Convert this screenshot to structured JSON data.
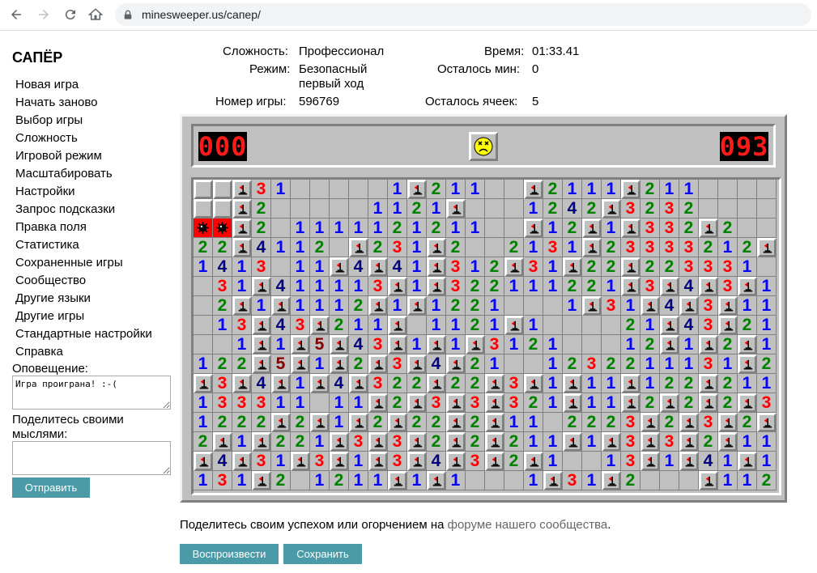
{
  "browser": {
    "url": "minesweeper.us/сапер/"
  },
  "sidebar": {
    "title": "САПЁР",
    "menu": [
      "Новая игра",
      "Начать заново",
      "Выбор игры",
      "Сложность",
      "Игровой режим",
      "Масштабировать",
      "Настройки",
      "Запрос подсказки",
      "Правка поля",
      "Статистика",
      "Сохраненные игры",
      "Сообщество",
      "Другие языки",
      "Другие игры",
      "Стандартные настройки",
      "Справка"
    ],
    "notice_label": "Оповещение:",
    "notice_text": "Игра проиграна! :-(",
    "share_label": "Поделитесь своими мыслями:",
    "send_button": "Отправить"
  },
  "info": {
    "difficulty_label": "Сложность:",
    "difficulty_value": "Профессионал",
    "mode_label": "Режим:",
    "mode_value_line1": "Безопасный",
    "mode_value_line2": "первый ход",
    "game_number_label": "Номер игры:",
    "game_number_value": "596769",
    "time_label": "Время:",
    "time_value": "01:33.41",
    "mines_left_label": "Осталось мин:",
    "mines_left_value": "0",
    "cells_left_label": "Осталось ячеек:",
    "cells_left_value": "5"
  },
  "game": {
    "mine_counter": "000",
    "timer": "093",
    "face_state": "dead-face-icon",
    "legend": "H hidden cell, F flag, M mine, X exploded mine, 0 empty revealed, 1-8 mine counts",
    "board": [
      "HHF31000001F21100F2111F21100000",
      "HHF2000001121F0001242F32320000",
      "XMF20111112121100F12F1F332F200111",
      "22F41120F231F2002131F23333212F0022",
      "1413011F4F41F312F31F22F223331013F2",
      "031F411113F1F322111221F3F4F3F1112F32",
      "02F1F1112F1F12210001F31F4F3F1122F21",
      "013F43F211F01121F1000021F43F2101122F1",
      "001F1F5F43F1F1F312100012F1F2F1F122F21",
      "122F5F1F2F3F4F21001232211131F2F1F210",
      "F3F4F1F4F322F22F3F1F11F122F211010123210",
      "133311011F2F3F3F321F11F2F2F2F3F310022F421",
      "1222F2F1F2F22F2F1102223F2F3F2F0002F1F1F2",
      "2F1F221F3F3F2F2F211F1F3F3F2F112F3F12F22F4F32",
      "F4F31F3F1F3F4F3F2F10013F1F41F1002F33F1F1121",
      "131F201211F1F10001F31F2000F1121F11F1F21"
    ]
  }
}
